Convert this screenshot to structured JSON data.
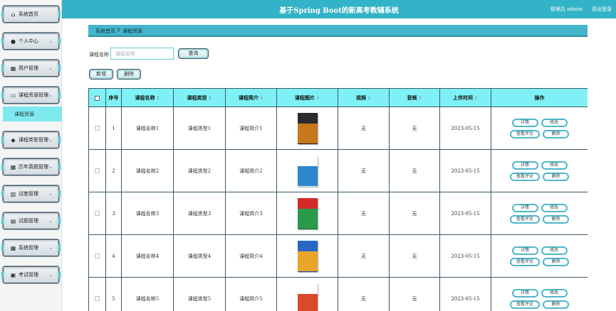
{
  "header": {
    "title": "基于Spring Boot的新高考教辅系统",
    "user": "管理员 admin",
    "logout": "退出登录"
  },
  "sidebar": {
    "items": [
      {
        "label": "系统首页",
        "icon": "home-icon",
        "glyph": "⌂",
        "chevron": ""
      },
      {
        "label": "个人中心",
        "icon": "user-icon",
        "glyph": "●",
        "chevron": "⌄"
      },
      {
        "label": "用户管理",
        "icon": "grid-icon",
        "glyph": "▦",
        "chevron": "⌄"
      },
      {
        "label": "课程资源管理",
        "icon": "monitor-icon",
        "glyph": "▭",
        "chevron": "⌄"
      },
      {
        "label": "课程类型管理",
        "icon": "drop-icon",
        "glyph": "◆",
        "chevron": "⌄"
      },
      {
        "label": "历年真题管理",
        "icon": "grid-icon",
        "glyph": "▦",
        "chevron": "⌄"
      },
      {
        "label": "试卷管理",
        "icon": "chart-icon",
        "glyph": "▥",
        "chevron": "⌄"
      },
      {
        "label": "试题管理",
        "icon": "card-icon",
        "glyph": "▤",
        "chevron": "⌄"
      },
      {
        "label": "系统管理",
        "icon": "grid-icon",
        "glyph": "▦",
        "chevron": "⌄"
      },
      {
        "label": "考试管理",
        "icon": "calendar-icon",
        "glyph": "▣",
        "chevron": "⌄"
      }
    ],
    "submenu": "课程资源"
  },
  "breadcrumb": {
    "home": "系统首页",
    "sep": "⠿",
    "current": "课程资源"
  },
  "search": {
    "label": "课程名称",
    "placeholder": "课程名称",
    "value": "",
    "button": "查询"
  },
  "toolbar": {
    "add": "新增",
    "delete": "删除"
  },
  "table": {
    "headers": [
      "序号",
      "课程名称",
      "课程类型",
      "课程简介",
      "课程图片",
      "视频",
      "音频",
      "上传时间",
      "操作"
    ],
    "rows": [
      {
        "no": "1",
        "name": "课程名称1",
        "type": "课程类型1",
        "intro": "课程简介1",
        "video": "无",
        "audio": "无",
        "time": "2023-05-15"
      },
      {
        "no": "2",
        "name": "课程名称2",
        "type": "课程类型2",
        "intro": "课程简介2",
        "video": "无",
        "audio": "无",
        "time": "2023-05-15"
      },
      {
        "no": "3",
        "name": "课程名称3",
        "type": "课程类型3",
        "intro": "课程简介3",
        "video": "无",
        "audio": "无",
        "time": "2023-05-15"
      },
      {
        "no": "4",
        "name": "课程名称4",
        "type": "课程类型4",
        "intro": "课程简介4",
        "video": "无",
        "audio": "无",
        "time": "2023-05-15"
      },
      {
        "no": "5",
        "name": "课程名称5",
        "type": "课程类型5",
        "intro": "课程简介5",
        "video": "无",
        "audio": "无",
        "time": "2023-05-15"
      }
    ],
    "actions": {
      "detail": "详情",
      "edit": "修改",
      "comments": "查看评论",
      "delete": "删除"
    }
  },
  "colors": {
    "header": "#33b3c7",
    "breadcrumb": "#44b5cb",
    "table_head": "#7ff0f5",
    "accent": "#4fb6c9"
  }
}
